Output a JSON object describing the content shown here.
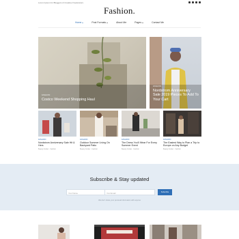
{
  "topbar": {
    "tagline": "Lorem Ipsum for Bloggers & Creative Freelancers",
    "social_icons": [
      "facebook-icon",
      "twitter-icon",
      "instagram-icon",
      "pinterest-icon"
    ]
  },
  "site": {
    "logo": "Fashion."
  },
  "nav": {
    "items": [
      {
        "label": "Home",
        "active": true,
        "has_dropdown": true
      },
      {
        "label": "Post Formats",
        "active": false,
        "has_dropdown": true
      },
      {
        "label": "About Me",
        "active": false,
        "has_dropdown": false
      },
      {
        "label": "Pages",
        "active": false,
        "has_dropdown": true
      },
      {
        "label": "Contact Me",
        "active": false,
        "has_dropdown": false
      }
    ]
  },
  "featured": [
    {
      "category": "Fashion",
      "title": "Costco Weekend Shopping Haul"
    },
    {
      "category": "Fashion",
      "title": "Nordstrom Anniversary Sale 2019 Pieces To Add To Your Cart"
    }
  ],
  "posts": [
    {
      "category": "Fashion",
      "title": "Nordstrom Anniversary Sale Hit & Hers",
      "meta": "Beauty Insider · Fashion"
    },
    {
      "category": "Fashion",
      "title": "Outdoor Summer Living On Backyard Patio",
      "meta": "Beauty Insider · Fashion"
    },
    {
      "category": "Fashion",
      "title": "The Dress You'll Wear For Every Summer Event",
      "meta": "Beauty Insider · Fashion"
    },
    {
      "category": "Fashion",
      "title": "The Easiest Way to Plan a Trip to Europe on Any Budget",
      "meta": "Beauty Insider · Fashion"
    }
  ],
  "subscribe": {
    "heading": "Subscribe & Stay updated",
    "name_placeholder": "Your Name",
    "email_placeholder": "Your Email",
    "button": "Subscribe",
    "note": "We don't share your personal information with anyone"
  },
  "colors": {
    "accent": "#2f6fb6",
    "subscribe_bg": "#e4ecf4"
  }
}
